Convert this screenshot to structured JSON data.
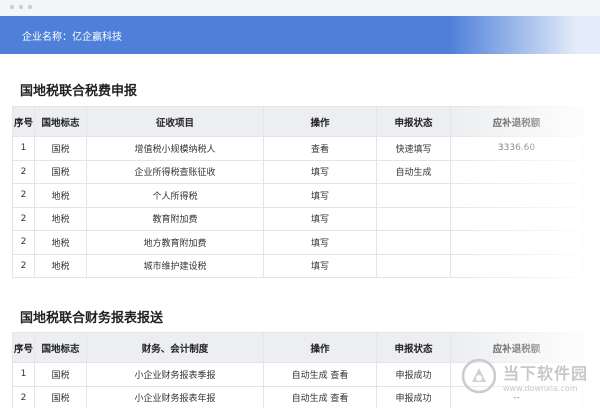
{
  "banner": {
    "company_label": "企业名称：亿企赢科技"
  },
  "section1": {
    "title": "国地税联合税费申报",
    "headers": [
      "序号",
      "国地标志",
      "征收项目",
      "操作",
      "申报状态",
      "应补退税额"
    ],
    "rows": [
      [
        "1",
        "国税",
        "增值税小规模纳税人",
        "查看",
        "快速填写",
        "3336.60"
      ],
      [
        "2",
        "国税",
        "企业所得税查账征收",
        "填写",
        "自动生成",
        ""
      ],
      [
        "2",
        "地税",
        "个人所得税",
        "填写",
        "",
        ""
      ],
      [
        "2",
        "地税",
        "教育附加费",
        "填写",
        "",
        ""
      ],
      [
        "2",
        "地税",
        "地方教育附加费",
        "填写",
        "",
        ""
      ],
      [
        "2",
        "地税",
        "城市维护建设税",
        "填写",
        "",
        ""
      ]
    ]
  },
  "section2": {
    "title": "国地税联合财务报表报送",
    "headers": [
      "序号",
      "国地标志",
      "财务、会计制度",
      "操作",
      "申报状态",
      "应补退税额"
    ],
    "rows": [
      [
        "1",
        "国税",
        "小企业财务报表季报",
        "自动生成  查看",
        "申报成功",
        ""
      ],
      [
        "2",
        "国税",
        "小企业财务报表年报",
        "自动生成  查看",
        "申报成功",
        "--"
      ]
    ]
  },
  "watermark": {
    "name": "当下软件园",
    "url": "www.downxia.com"
  }
}
